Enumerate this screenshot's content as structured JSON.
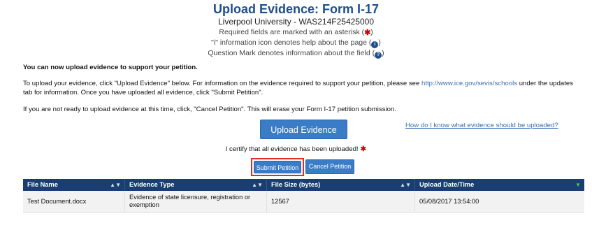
{
  "header": {
    "title": "Upload Evidence: Form I-17",
    "subtitle": "Liverpool University - WAS214F25425000",
    "notes": {
      "required": "Required fields are marked with an asterisk (",
      "info": "\"i\" information icon denotes help about the page (",
      "question": "Question Mark denotes information about the field (",
      "close_paren": ")"
    },
    "icons": {
      "required_glyph": "✱",
      "info_glyph": "i",
      "question_glyph": "?"
    }
  },
  "intro": {
    "heading": "You can now upload evidence to support your petition.",
    "instruction_before": "To upload your evidence, click \"Upload Evidence\" below. For information on the evidence required to support your petition, please see ",
    "instruction_link": "http://www.ice.gov/sevis/schools",
    "instruction_after": " under the updates tab for information. Once you have uploaded all evidence, click \"Submit Petition\".",
    "cancel_note": "If you are not ready to upload evidence at this time, click, \"Cancel Petition\". This will erase your Form I-17 petition submission."
  },
  "actions": {
    "upload_label": "Upload Evidence",
    "help_link": "How do I know what evidence should be uploaded?",
    "certify_text": "I certify that all evidence has been uploaded!",
    "submit_label": "Submit Petition",
    "cancel_label": "Cancel Petition"
  },
  "table": {
    "columns": [
      "File Name",
      "Evidence Type",
      "File Size (bytes)",
      "Upload Date/Time"
    ],
    "rows": [
      [
        "Test Document.docx",
        "Evidence of state licensure, registration or exemption",
        "12567",
        "05/08/2017 13:54:00"
      ]
    ]
  },
  "colors": {
    "title": "#1e4e8c",
    "button": "#3a7dc6",
    "table_header": "#1a3d73",
    "highlight": "#d9302c",
    "required": "#cc0000"
  }
}
